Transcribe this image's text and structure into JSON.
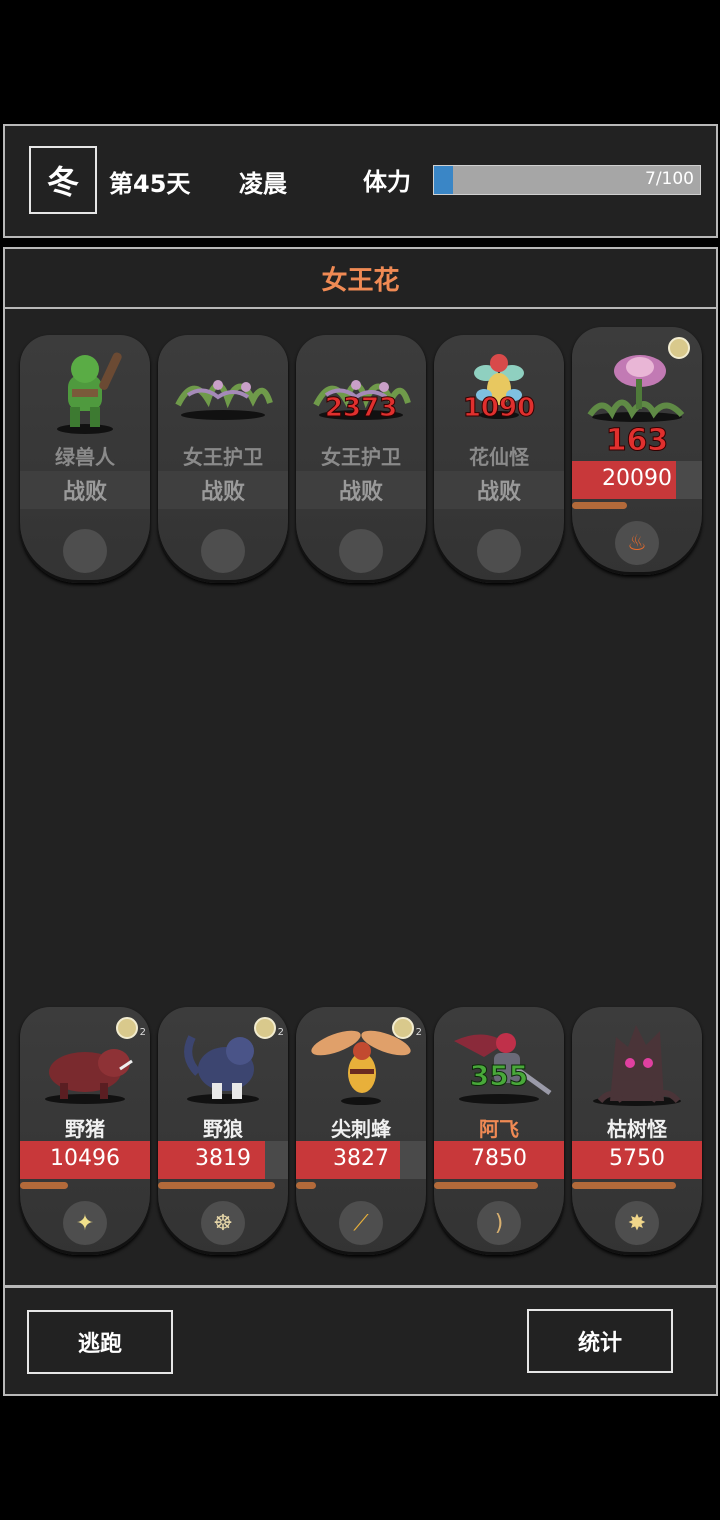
{
  "header": {
    "season": "冬",
    "day": "第45天",
    "time_of_day": "凌晨",
    "stamina_label": "体力",
    "stamina_text": "7/100",
    "stamina_fraction": 0.07
  },
  "enemy_title": "女王花",
  "enemies": [
    {
      "name": "绿兽人",
      "status": "战败",
      "portrait": "green-orc-sprite"
    },
    {
      "name": "女王护卫",
      "status": "战败",
      "portrait": "vine-guard-sprite"
    },
    {
      "name": "女王护卫",
      "status": "战败",
      "damage": "2373",
      "portrait": "vine-guard-sprite"
    },
    {
      "name": "花仙怪",
      "status": "战败",
      "damage": "1090",
      "portrait": "flower-fairy-sprite"
    },
    {
      "name": "女王花",
      "hp": "20090",
      "hp_fraction": 0.8,
      "atb_fraction": 0.42,
      "damage": "163",
      "skill_icon": "fire-pillar-icon",
      "portrait": "queen-flower-sprite",
      "badge": "1"
    }
  ],
  "allies": [
    {
      "name": "野猪",
      "hp": "10496",
      "hp_fraction": 1.0,
      "atb_fraction": 0.37,
      "skill_icon": "sparkle-icon",
      "badge": "2",
      "portrait": "wild-boar-sprite"
    },
    {
      "name": "野狼",
      "hp": "3819",
      "hp_fraction": 0.82,
      "atb_fraction": 0.9,
      "skill_icon": "claw-icon",
      "badge": "2",
      "portrait": "wolf-sprite"
    },
    {
      "name": "尖刺蜂",
      "hp": "3827",
      "hp_fraction": 0.8,
      "atb_fraction": 0.15,
      "skill_icon": "stinger-icon",
      "badge": "2",
      "portrait": "hornet-sprite"
    },
    {
      "name": "阿飞",
      "hp": "7850",
      "hp_fraction": 1.0,
      "atb_fraction": 0.8,
      "skill_icon": "bow-icon",
      "damage": "355",
      "portrait": "afei-hero-sprite",
      "highlight": true
    },
    {
      "name": "枯树怪",
      "hp": "5750",
      "hp_fraction": 1.0,
      "atb_fraction": 0.8,
      "skill_icon": "spike-icon",
      "portrait": "dead-tree-sprite"
    }
  ],
  "buttons": {
    "escape": "逃跑",
    "stats": "统计"
  },
  "colors": {
    "accent_orange": "#f08a54",
    "hp_red": "#c8383a",
    "stamina_blue": "#3a86c6"
  }
}
